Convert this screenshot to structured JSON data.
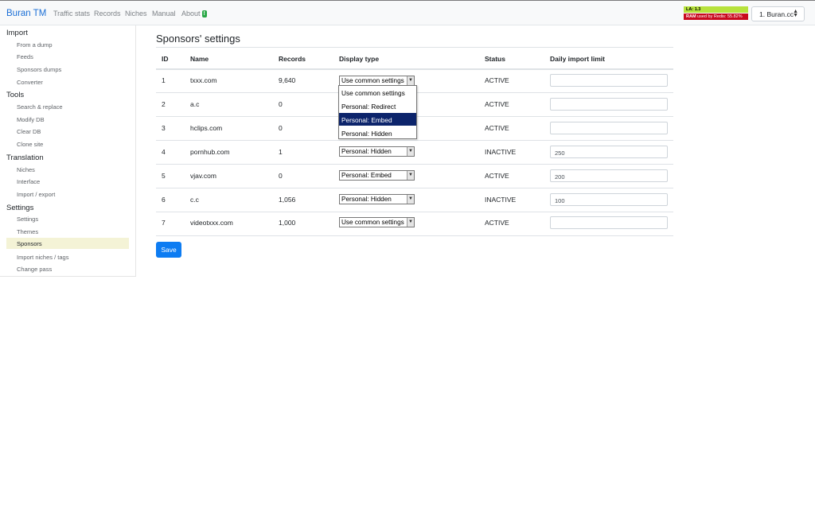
{
  "navbar": {
    "brand": "Buran TM",
    "links": [
      "Traffic stats",
      "Records",
      "Niches",
      "Manual",
      "About"
    ],
    "about_badge": "!",
    "la_label": "LA: 1.3",
    "ram_label_prefix": "RAM",
    "ram_label": " used by Redis: 55.82%",
    "site_selected": "1. Buran.cc"
  },
  "colors": {
    "brand": "#1b6fd6",
    "la_bar": "#b7e23c",
    "ram_bar": "#c80a1e",
    "save_button": "#0d7cf2",
    "active_item": "#f4f3d6",
    "option_selected": "#0c246b"
  },
  "sidebar": {
    "sections": [
      {
        "title": "Import",
        "items": [
          "From a dump",
          "Feeds",
          "Sponsors dumps",
          "Converter"
        ]
      },
      {
        "title": "Tools",
        "items": [
          "Search & replace",
          "Modify DB",
          "Clear DB",
          "Clone site"
        ]
      },
      {
        "title": "Translation",
        "items": [
          "Niches",
          "Interface",
          "Import / export"
        ]
      },
      {
        "title": "Settings",
        "items": [
          "Settings",
          "Themes",
          "Sponsors",
          "Import niches / tags",
          "Change pass"
        ]
      }
    ],
    "active_item": "Sponsors"
  },
  "main": {
    "title": "Sponsors' settings",
    "columns": [
      "ID",
      "Name",
      "Records",
      "Display type",
      "Status",
      "Daily import limit"
    ],
    "rows": [
      {
        "id": "1",
        "name": "txxx.com",
        "records": "9,640",
        "display": "Use common settings",
        "status": "ACTIVE",
        "limit": ""
      },
      {
        "id": "2",
        "name": "a.c",
        "records": "0",
        "display": "",
        "status": "ACTIVE",
        "limit": ""
      },
      {
        "id": "3",
        "name": "hclips.com",
        "records": "0",
        "display": "",
        "status": "ACTIVE",
        "limit": ""
      },
      {
        "id": "4",
        "name": "pornhub.com",
        "records": "1",
        "display": "Personal: Hidden",
        "status": "INACTIVE",
        "limit": "250"
      },
      {
        "id": "5",
        "name": "vjav.com",
        "records": "0",
        "display": "Personal: Embed",
        "status": "ACTIVE",
        "limit": "200"
      },
      {
        "id": "6",
        "name": "c.c",
        "records": "1,056",
        "display": "Personal: Hidden",
        "status": "INACTIVE",
        "limit": "100"
      },
      {
        "id": "7",
        "name": "videotxxx.com",
        "records": "1,000",
        "display": "Use common settings",
        "status": "ACTIVE",
        "limit": ""
      }
    ],
    "dropdown_options": [
      "Use common settings",
      "Personal: Redirect",
      "Personal: Embed",
      "Personal: Hidden"
    ],
    "dropdown_highlighted": "Personal: Embed",
    "save_label": "Save"
  }
}
